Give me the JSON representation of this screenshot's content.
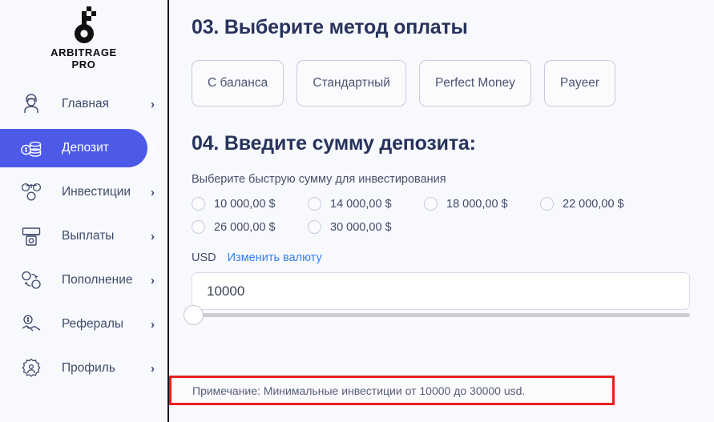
{
  "brand": {
    "name_line1": "ARBITRAGE",
    "name_line2": "PRO",
    "logo_icon": "key-icon"
  },
  "sidebar": {
    "items": [
      {
        "label": "Главная",
        "icon": "user-support-icon",
        "chevron": "›",
        "active": false
      },
      {
        "label": "Депозит",
        "icon": "coins-stack-icon",
        "chevron": "›",
        "active": true
      },
      {
        "label": "Инвестиции",
        "icon": "money-scale-icon",
        "chevron": "›",
        "active": false
      },
      {
        "label": "Выплаты",
        "icon": "atm-cash-icon",
        "chevron": "›",
        "active": false
      },
      {
        "label": "Пополнение",
        "icon": "currency-swap-icon",
        "chevron": "›",
        "active": false
      },
      {
        "label": "Рефералы",
        "icon": "handshake-coin-icon",
        "chevron": "›",
        "active": false
      },
      {
        "label": "Профиль",
        "icon": "gear-user-icon",
        "chevron": "›",
        "active": false
      }
    ],
    "active_color": "#4d5ae8"
  },
  "main": {
    "section_03_title": "03. Выберите метод оплаты",
    "payment_methods": [
      {
        "label": "С баланса"
      },
      {
        "label": "Стандартный"
      },
      {
        "label": "Perfect Money"
      },
      {
        "label": "Payeer"
      }
    ],
    "section_04_title": "04. Введите сумму депозита:",
    "quick_hint": "Выберите быструю сумму для инвестирования",
    "quick_amounts": [
      {
        "label": "10 000,00 $",
        "selected": false
      },
      {
        "label": "14 000,00 $",
        "selected": false
      },
      {
        "label": "18 000,00 $",
        "selected": false
      },
      {
        "label": "22 000,00 $",
        "selected": false
      },
      {
        "label": "26 000,00 $",
        "selected": false
      },
      {
        "label": "30 000,00 $",
        "selected": false
      }
    ],
    "currency_code": "USD",
    "currency_change_link": "Изменить валюту",
    "amount_value": "10000",
    "amount_placeholder": "10000",
    "note_text": "Примечание: Минимальные инвестиции от 10000 до 30000 usd.",
    "note_highlight_color": "#e81f1f"
  }
}
